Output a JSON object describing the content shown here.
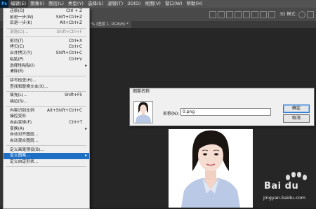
{
  "menubar": {
    "logo": "Ps",
    "items": [
      "编辑(E)",
      "图像(I)",
      "图层(L)",
      "类型(Y)",
      "选择(S)",
      "滤镜(T)",
      "3D(D)",
      "视图(V)",
      "窗口(W)",
      "帮助(H)"
    ]
  },
  "options": {
    "mode_label": "3D 模式:"
  },
  "document": {
    "tab": "% (图层 1, RGB/8) *"
  },
  "edit_menu": [
    {
      "label": "还原(O)",
      "shortcut": "Ctrl + Z"
    },
    {
      "label": "前进一步(W)",
      "shortcut": "Shift+Ctrl+Z"
    },
    {
      "label": "后退一步(K)",
      "shortcut": "Alt+Ctrl+Z"
    },
    {
      "sep": true
    },
    {
      "label": "渐隐(D)...",
      "shortcut": "Shift+Ctrl+F",
      "disabled": true
    },
    {
      "sep": true
    },
    {
      "label": "剪切(T)",
      "shortcut": "Ctrl+X"
    },
    {
      "label": "拷贝(C)",
      "shortcut": "Ctrl+C"
    },
    {
      "label": "合并拷贝(Y)",
      "shortcut": "Shift+Ctrl+C"
    },
    {
      "label": "粘贴(P)",
      "shortcut": "Ctrl+V"
    },
    {
      "label": "选择性粘贴(I)",
      "submenu": true
    },
    {
      "label": "清除(E)"
    },
    {
      "sep": true
    },
    {
      "label": "拼写检查(H)..."
    },
    {
      "label": "查找和替换文本(X)..."
    },
    {
      "sep": true
    },
    {
      "label": "填充(L)...",
      "shortcut": "Shift+F5"
    },
    {
      "label": "描边(S)..."
    },
    {
      "sep": true
    },
    {
      "label": "内容识别比例",
      "shortcut": "Alt+Shift+Ctrl+C"
    },
    {
      "label": "操控变形"
    },
    {
      "label": "自由变换(F)",
      "shortcut": "Ctrl+T"
    },
    {
      "label": "变换(A)",
      "submenu": true
    },
    {
      "label": "自动对齐图层..."
    },
    {
      "label": "自动混合图层..."
    },
    {
      "sep": true
    },
    {
      "label": "定义画笔预设(B)..."
    },
    {
      "label": "定义图案...",
      "highlighted": true,
      "submenu": true
    },
    {
      "label": "定义自定形状..."
    },
    {
      "sep": true
    }
  ],
  "dialog": {
    "title": "图案名称",
    "name_label": "名称(N):",
    "name_value": "0.png",
    "ok": "确定",
    "cancel": "取消"
  },
  "watermark": {
    "brand": "Bai du",
    "url": "jingyan.baidu.com"
  },
  "colors": {
    "menubar": "#535353",
    "highlight": "#1f6fc4",
    "canvas": "#262626",
    "shirt": "#b9c9e6"
  }
}
